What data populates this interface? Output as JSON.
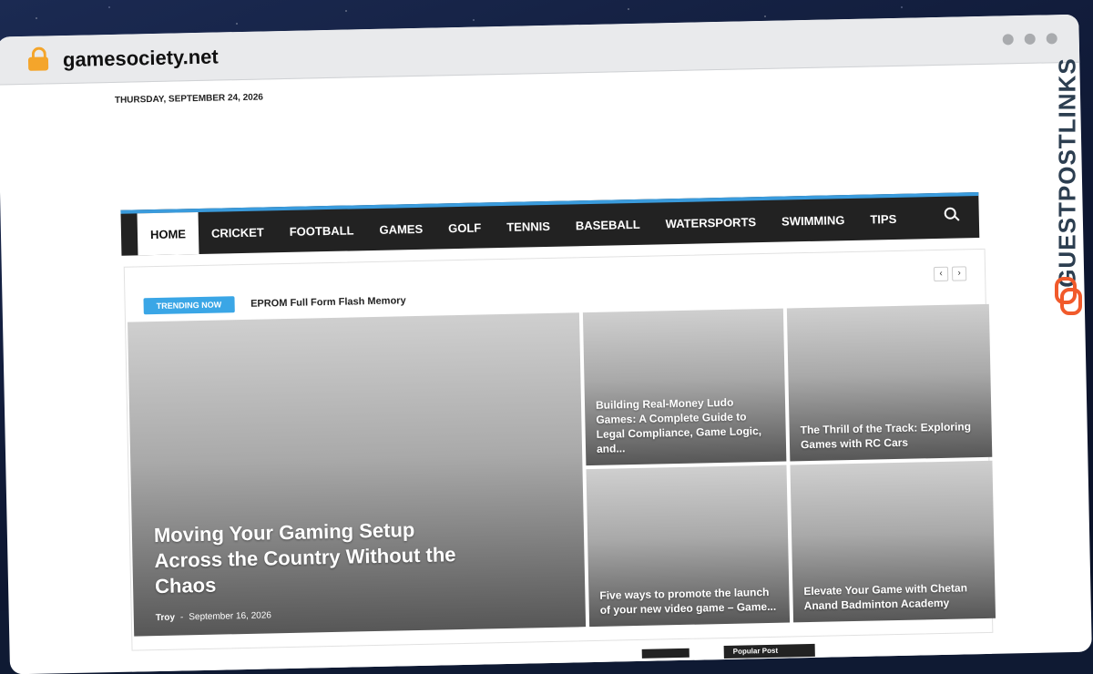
{
  "browser": {
    "url": "gamesociety.net"
  },
  "page": {
    "date": "THURSDAY, SEPTEMBER 24, 2026"
  },
  "nav": {
    "items": [
      "HOME",
      "CRICKET",
      "FOOTBALL",
      "GAMES",
      "GOLF",
      "TENNIS",
      "BASEBALL",
      "WATERSPORTS",
      "SWIMMING",
      "TIPS"
    ],
    "active": "HOME"
  },
  "trending": {
    "badge": "TRENDING NOW",
    "title": "EPROM Full Form Flash Memory"
  },
  "featured": {
    "big": {
      "title": "Moving Your Gaming Setup Across the Country Without the Chaos",
      "author": "Troy",
      "separator": "-",
      "date": "September 16, 2026"
    },
    "tiles": [
      "Building Real-Money Ludo Games: A Complete Guide to Legal Compliance, Game Logic, and...",
      "The Thrill of the Track: Exploring Games with RC Cars",
      "Five ways to promote the launch of your new video game – Game...",
      "Elevate Your Game with Chetan Anand Badminton Academy"
    ]
  },
  "sidebar_tab": "Popular Post",
  "watermark": {
    "text": "GUESTPOSTLINKS"
  },
  "colors": {
    "accent": "#3a9bdc",
    "nav_bg": "#222222",
    "badge": "#3aa6e6",
    "watermark_logo": "#f15a2b"
  },
  "icons": [
    "lock-icon",
    "search-icon",
    "chevron-left-icon",
    "chevron-right-icon"
  ]
}
